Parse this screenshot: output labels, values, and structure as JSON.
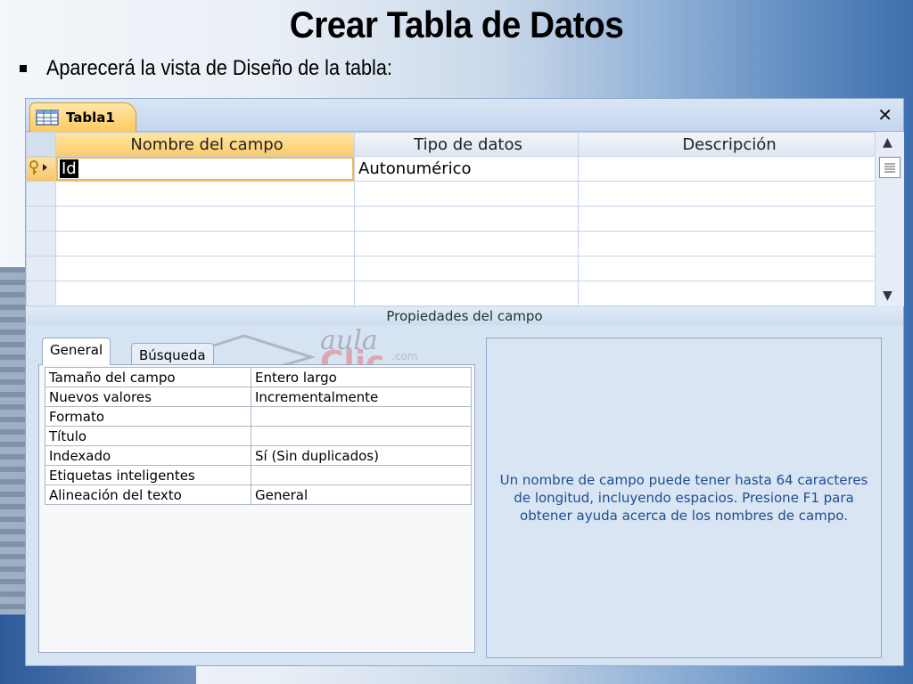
{
  "slide": {
    "title": "Crear Tabla de Datos",
    "bullet": "Aparecerá la vista de Diseño de la tabla:"
  },
  "window": {
    "tab_label": "Tabla1",
    "close_glyph": "✕",
    "tab_icon": "table-icon"
  },
  "grid": {
    "headers": [
      "Nombre del campo",
      "Tipo de datos",
      "Descripción"
    ],
    "rows": [
      {
        "name": "Id",
        "type": "Autonumérico",
        "desc": "",
        "primary_key": true
      },
      {
        "name": "",
        "type": "",
        "desc": ""
      },
      {
        "name": "",
        "type": "",
        "desc": ""
      },
      {
        "name": "",
        "type": "",
        "desc": ""
      },
      {
        "name": "",
        "type": "",
        "desc": ""
      },
      {
        "name": "",
        "type": "",
        "desc": ""
      }
    ]
  },
  "properties": {
    "header": "Propiedades del campo",
    "tabs": [
      "General",
      "Búsqueda"
    ],
    "rows": [
      {
        "key": "Tamaño del campo",
        "value": "Entero largo"
      },
      {
        "key": "Nuevos valores",
        "value": "Incrementalmente"
      },
      {
        "key": "Formato",
        "value": ""
      },
      {
        "key": "Título",
        "value": ""
      },
      {
        "key": "Indexado",
        "value": "Sí (Sin duplicados)"
      },
      {
        "key": "Etiquetas inteligentes",
        "value": ""
      },
      {
        "key": "Alineación del texto",
        "value": "General"
      }
    ],
    "help_text": "Un nombre de campo puede tener hasta 64 caracteres de longitud, incluyendo espacios. Presione F1 para obtener ayuda acerca de los nombres de campo."
  },
  "watermark": {
    "aula": "aula",
    "com": ".com",
    "clic": "Clic"
  }
}
